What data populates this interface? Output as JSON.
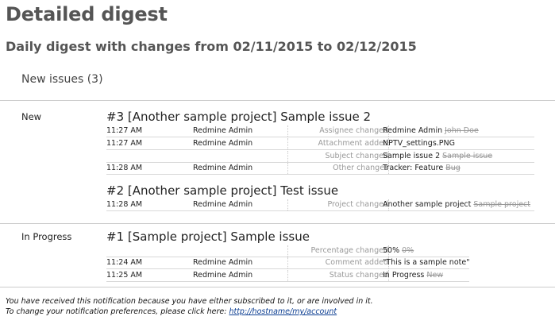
{
  "title": "Detailed digest",
  "subtitle": "Daily digest with changes from 02/11/2015 to 02/12/2015",
  "section": "New issues (3)",
  "groups": [
    {
      "status": "New",
      "issues": [
        {
          "title": "#3 [Another sample project] Sample issue 2",
          "rows": [
            {
              "time": "11:27 AM",
              "user": "Redmine Admin",
              "label": "Assignee changed",
              "new": "Redmine Admin",
              "old": "John Doe"
            },
            {
              "time": "11:27 AM",
              "user": "Redmine Admin",
              "label": "Attachment added",
              "new": "NPTV_settings.PNG",
              "old": ""
            },
            {
              "time": "",
              "user": "",
              "label": "Subject changed",
              "new": "Sample issue 2",
              "old": "Sample issue"
            },
            {
              "time": "11:28 AM",
              "user": "Redmine Admin",
              "label": "Other changes",
              "new": "Tracker:  Feature",
              "old": "Bug"
            }
          ]
        },
        {
          "title": "#2 [Another sample project] Test issue",
          "rows": [
            {
              "time": "11:28 AM",
              "user": "Redmine Admin",
              "label": "Project changed",
              "new": "Another sample project",
              "old": "Sample project"
            }
          ]
        }
      ]
    },
    {
      "status": "In Progress",
      "issues": [
        {
          "title": "#1 [Sample project] Sample issue",
          "rows": [
            {
              "time": "",
              "user": "",
              "label": "Percentage changed",
              "new": "50%",
              "old": "0%"
            },
            {
              "time": "11:24 AM",
              "user": "Redmine Admin",
              "label": "Comment added",
              "new": "\"This is a sample note\"",
              "old": ""
            },
            {
              "time": "11:25 AM",
              "user": "Redmine Admin",
              "label": "Status changed",
              "new": "In Progress",
              "old": "New"
            }
          ]
        }
      ]
    }
  ],
  "footer": {
    "line1": "You have received this notification because you have either subscribed to it, or are involved in it.",
    "line2_prefix": "To change your notification preferences, please click here: ",
    "link": "http://hostname/my/account"
  }
}
